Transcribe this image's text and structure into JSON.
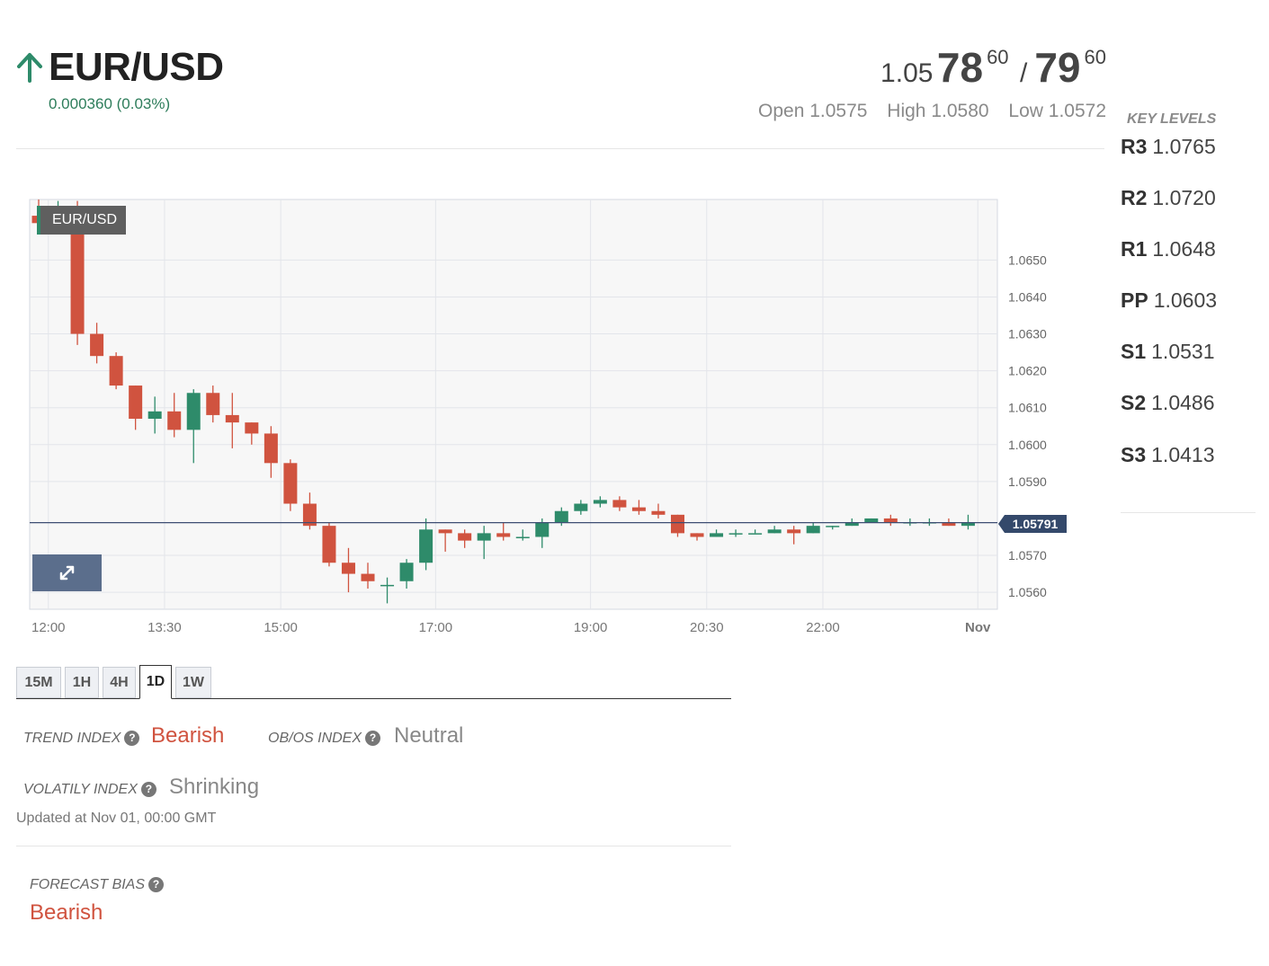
{
  "header": {
    "pair": "EUR/USD",
    "change": "0.000360 (0.03%)",
    "price": {
      "bid_prefix": "1.05",
      "bid_main": "78",
      "bid_pip": "60",
      "separator": "/",
      "ask_main": "79",
      "ask_pip": "60"
    },
    "open": "Open 1.0575",
    "high": "High 1.0580",
    "low": "Low 1.0572",
    "colors": {
      "up": "#2e8b6a",
      "down": "#d0533f"
    }
  },
  "key_levels": {
    "title": "KEY LEVELS",
    "items": [
      {
        "label": "R3",
        "value": "1.0765"
      },
      {
        "label": "R2",
        "value": "1.0720"
      },
      {
        "label": "R1",
        "value": "1.0648"
      },
      {
        "label": "PP",
        "value": "1.0603"
      },
      {
        "label": "S1",
        "value": "1.0531"
      },
      {
        "label": "S2",
        "value": "1.0486"
      },
      {
        "label": "S3",
        "value": "1.0413"
      }
    ]
  },
  "chart_tag": "EUR/USD",
  "chart_data": {
    "type": "candlestick",
    "series_name": "EUR/USD",
    "y_range": [
      1.05554,
      1.06664
    ],
    "y_ticks": [
      "1.0650",
      "1.0640",
      "1.0630",
      "1.0620",
      "1.0610",
      "1.0600",
      "1.0590",
      "1.0570",
      "1.0560"
    ],
    "x_ticks": [
      {
        "label": "12:00",
        "index": 0.5
      },
      {
        "label": "13:30",
        "index": 6.5
      },
      {
        "label": "15:00",
        "index": 12.5
      },
      {
        "label": "17:00",
        "index": 20.5
      },
      {
        "label": "19:00",
        "index": 28.5
      },
      {
        "label": "20:30",
        "index": 34.5
      },
      {
        "label": "22:00",
        "index": 40.5
      },
      {
        "label": "Nov",
        "index": 48.5
      }
    ],
    "current_price": 1.05791,
    "current_price_label": "1.05791",
    "grid": true,
    "candles": [
      {
        "o": 1.0662,
        "h": 1.0667,
        "l": 1.0658,
        "c": 1.066
      },
      {
        "o": 1.0658,
        "h": 1.0666,
        "l": 1.0657,
        "c": 1.0664
      },
      {
        "o": 1.0664,
        "h": 1.0666,
        "l": 1.0627,
        "c": 1.063
      },
      {
        "o": 1.063,
        "h": 1.0633,
        "l": 1.0622,
        "c": 1.0624
      },
      {
        "o": 1.0624,
        "h": 1.0625,
        "l": 1.0615,
        "c": 1.0616
      },
      {
        "o": 1.0616,
        "h": 1.0616,
        "l": 1.0604,
        "c": 1.0607
      },
      {
        "o": 1.0607,
        "h": 1.0613,
        "l": 1.0603,
        "c": 1.0609
      },
      {
        "o": 1.0609,
        "h": 1.0614,
        "l": 1.0602,
        "c": 1.0604
      },
      {
        "o": 1.0604,
        "h": 1.0615,
        "l": 1.0595,
        "c": 1.0614
      },
      {
        "o": 1.0614,
        "h": 1.0616,
        "l": 1.0606,
        "c": 1.0608
      },
      {
        "o": 1.0608,
        "h": 1.0614,
        "l": 1.0599,
        "c": 1.0606
      },
      {
        "o": 1.0606,
        "h": 1.0606,
        "l": 1.06,
        "c": 1.0603
      },
      {
        "o": 1.0603,
        "h": 1.0605,
        "l": 1.0591,
        "c": 1.0595
      },
      {
        "o": 1.0595,
        "h": 1.0596,
        "l": 1.0582,
        "c": 1.0584
      },
      {
        "o": 1.0584,
        "h": 1.0587,
        "l": 1.0577,
        "c": 1.0578
      },
      {
        "o": 1.0578,
        "h": 1.0579,
        "l": 1.0567,
        "c": 1.0568
      },
      {
        "o": 1.0568,
        "h": 1.0572,
        "l": 1.056,
        "c": 1.0565
      },
      {
        "o": 1.0565,
        "h": 1.0568,
        "l": 1.0561,
        "c": 1.0563
      },
      {
        "o": 1.0562,
        "h": 1.0564,
        "l": 1.0557,
        "c": 1.0562
      },
      {
        "o": 1.0563,
        "h": 1.0569,
        "l": 1.0561,
        "c": 1.0568
      },
      {
        "o": 1.0568,
        "h": 1.058,
        "l": 1.0566,
        "c": 1.0577
      },
      {
        "o": 1.0577,
        "h": 1.0577,
        "l": 1.0571,
        "c": 1.0576
      },
      {
        "o": 1.0576,
        "h": 1.0577,
        "l": 1.0572,
        "c": 1.0574
      },
      {
        "o": 1.0574,
        "h": 1.0578,
        "l": 1.0569,
        "c": 1.0576
      },
      {
        "o": 1.0576,
        "h": 1.0579,
        "l": 1.0574,
        "c": 1.0575
      },
      {
        "o": 1.0575,
        "h": 1.0577,
        "l": 1.0574,
        "c": 1.0575
      },
      {
        "o": 1.0575,
        "h": 1.058,
        "l": 1.0572,
        "c": 1.0579
      },
      {
        "o": 1.0579,
        "h": 1.0583,
        "l": 1.0578,
        "c": 1.0582
      },
      {
        "o": 1.0582,
        "h": 1.0585,
        "l": 1.0581,
        "c": 1.0584
      },
      {
        "o": 1.0584,
        "h": 1.0586,
        "l": 1.0583,
        "c": 1.0585
      },
      {
        "o": 1.0585,
        "h": 1.0586,
        "l": 1.0582,
        "c": 1.0583
      },
      {
        "o": 1.0583,
        "h": 1.0585,
        "l": 1.0581,
        "c": 1.0582
      },
      {
        "o": 1.0582,
        "h": 1.0584,
        "l": 1.058,
        "c": 1.0581
      },
      {
        "o": 1.0581,
        "h": 1.0581,
        "l": 1.0575,
        "c": 1.0576
      },
      {
        "o": 1.0576,
        "h": 1.0576,
        "l": 1.0574,
        "c": 1.0575
      },
      {
        "o": 1.0575,
        "h": 1.0577,
        "l": 1.0575,
        "c": 1.0576
      },
      {
        "o": 1.0576,
        "h": 1.0577,
        "l": 1.0575,
        "c": 1.0576
      },
      {
        "o": 1.0576,
        "h": 1.0577,
        "l": 1.0576,
        "c": 1.0576
      },
      {
        "o": 1.0576,
        "h": 1.0578,
        "l": 1.0576,
        "c": 1.0577
      },
      {
        "o": 1.0577,
        "h": 1.0578,
        "l": 1.0573,
        "c": 1.0576
      },
      {
        "o": 1.0576,
        "h": 1.0579,
        "l": 1.0576,
        "c": 1.0578
      },
      {
        "o": 1.0578,
        "h": 1.0578,
        "l": 1.0577,
        "c": 1.0578
      },
      {
        "o": 1.0578,
        "h": 1.058,
        "l": 1.0578,
        "c": 1.0579
      },
      {
        "o": 1.0579,
        "h": 1.058,
        "l": 1.0579,
        "c": 1.058
      },
      {
        "o": 1.058,
        "h": 1.0581,
        "l": 1.0578,
        "c": 1.0579
      },
      {
        "o": 1.0579,
        "h": 1.058,
        "l": 1.0578,
        "c": 1.0579
      },
      {
        "o": 1.0579,
        "h": 1.058,
        "l": 1.0578,
        "c": 1.0579
      },
      {
        "o": 1.0579,
        "h": 1.058,
        "l": 1.0578,
        "c": 1.0578
      },
      {
        "o": 1.0578,
        "h": 1.0581,
        "l": 1.0577,
        "c": 1.0579
      }
    ]
  },
  "timeframes": {
    "items": [
      "15M",
      "1H",
      "4H",
      "1D",
      "1W"
    ],
    "active": "1D"
  },
  "indexes": {
    "trend_label": "TREND INDEX",
    "trend_value": "Bearish",
    "obos_label": "OB/OS INDEX",
    "obos_value": "Neutral",
    "volatility_label": "VOLATILY INDEX",
    "volatility_value": "Shrinking",
    "updated": "Updated at Nov 01, 00:00 GMT"
  },
  "forecast": {
    "label": "FORECAST BIAS",
    "value": "Bearish"
  }
}
